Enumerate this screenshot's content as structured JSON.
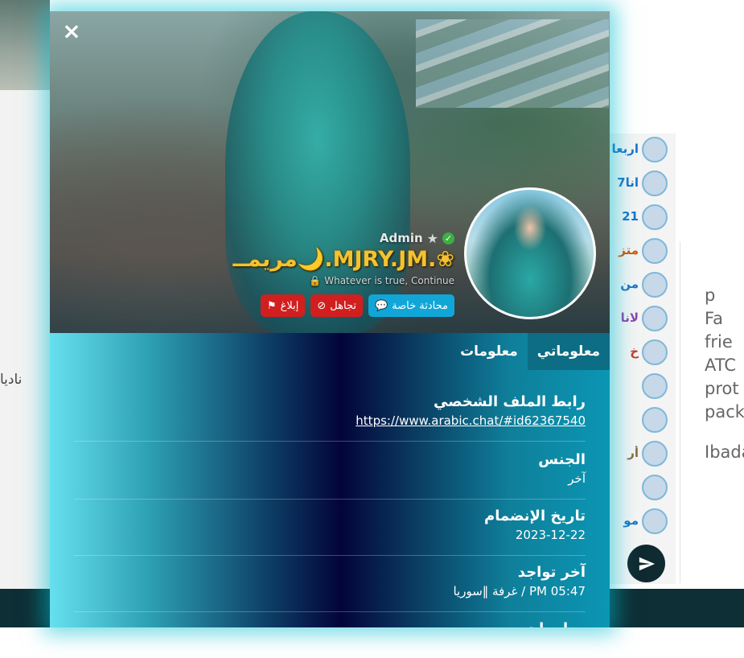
{
  "profile": {
    "close_label": "×",
    "role": "Admin",
    "username": "مريمــ🌙.MJRY.JM.❀",
    "mood": "Whatever is true, Continue",
    "actions": {
      "private_chat": "محادثة خاصة",
      "ignore": "تجاهل",
      "report": "إبلاغ"
    },
    "tabs": [
      {
        "label": "معلوماتي",
        "active": true
      },
      {
        "label": "معلومات",
        "active": false
      }
    ],
    "fields": [
      {
        "label": "رابط الملف الشخصي",
        "value": "https://www.arabic.chat/#id62367540"
      },
      {
        "label": "الجنس",
        "value": "آخر"
      },
      {
        "label": "تاريخ الإنضمام",
        "value": "2023-12-22"
      },
      {
        "label": "آخر تواجد",
        "value": "05:47 PM / غرفة ‖سوريا"
      },
      {
        "label": "معلومات",
        "value": ""
      }
    ]
  },
  "background": {
    "left_text": "ناديا",
    "userlist": [
      "اربعا",
      "انا7",
      "21",
      "متز",
      "من",
      "لانا",
      "خ",
      "",
      "",
      "أر",
      "",
      "مو"
    ],
    "right_panel_lines": [
      "p",
      "Fa",
      "frie",
      "ATC",
      "prot",
      "pack",
      "Ibada"
    ]
  },
  "icons": {
    "close": "close-icon",
    "star": "star-icon",
    "verified": "verified-check-icon",
    "lock": "lock-icon",
    "chat": "comments-icon",
    "ignore": "ban-icon",
    "report": "flag-icon",
    "send": "paper-plane-icon"
  },
  "colors": {
    "accent_cyan": "#11a6d8",
    "danger_red": "#d11f1f",
    "username_gold": "#f2c230",
    "tab_active": "#0c6d84"
  }
}
